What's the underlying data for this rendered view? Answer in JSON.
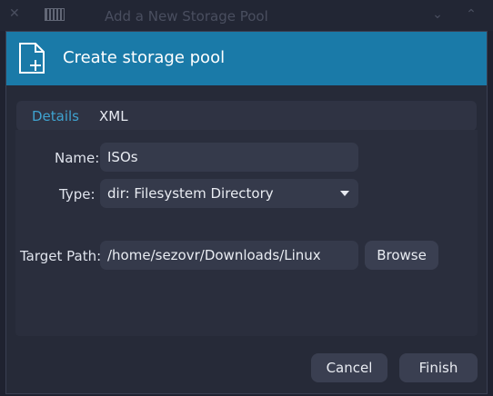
{
  "window": {
    "title": "Add a New Storage Pool"
  },
  "banner": {
    "title": "Create storage pool",
    "icon": "new-file-icon"
  },
  "tabs": [
    {
      "label": "Details",
      "active": true
    },
    {
      "label": "XML",
      "active": false
    }
  ],
  "form": {
    "name_label": "Name:",
    "name_value": "ISOs",
    "type_label": "Type:",
    "type_value": "dir: Filesystem Directory",
    "target_label": "Target Path:",
    "target_value": "/home/sezovr/Downloads/Linux",
    "browse_label": "Browse"
  },
  "actions": {
    "cancel_label": "Cancel",
    "finish_label": "Finish"
  },
  "colors": {
    "accent": "#1a7aa8",
    "tab_active": "#3fa3d0",
    "background": "#262a38"
  }
}
